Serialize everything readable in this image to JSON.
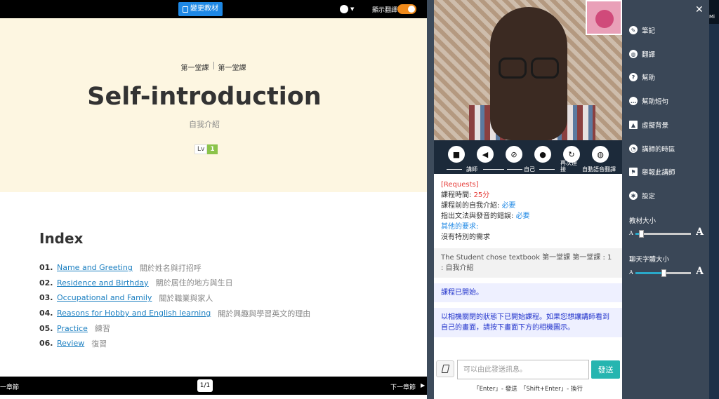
{
  "topbar": {
    "change_textbook": "變更教材",
    "show_translation": "顯示翻譯"
  },
  "lesson": {
    "breadcrumb": [
      "第一堂課",
      "第一堂課"
    ],
    "title": "Self-introduction",
    "subtitle": "自我介紹",
    "level_label": "Lv",
    "level_value": "1",
    "index_title": "Index",
    "index": [
      {
        "no": "01.",
        "title": "Name and Greeting",
        "zh": "關於姓名與打招呼"
      },
      {
        "no": "02.",
        "title": "Residence and Birthday",
        "zh": "關於居住的地方與生日"
      },
      {
        "no": "03.",
        "title": "Occupational and Family",
        "zh": "關於職業與家人"
      },
      {
        "no": "04.",
        "title": "Reasons for Hobby and English learning",
        "zh": "關於興趣與學習英文的理由"
      },
      {
        "no": "05.",
        "title": "Practice",
        "zh": "練習"
      },
      {
        "no": "06.",
        "title": "Review",
        "zh": "復習"
      }
    ]
  },
  "bottombar": {
    "prev": "一章節",
    "page": "1/1",
    "next": "下一章節"
  },
  "controls": {
    "tutor": "講師",
    "self": "自己",
    "reconnect": "再次連接",
    "auto_translate": "自動語音翻譯"
  },
  "chat": {
    "requests_title": "[Requests]",
    "duration_label": "課程時間: ",
    "duration_value": "25分",
    "intro_label": "課程前的自我介紹: ",
    "intro_value": "必要",
    "correction_label": "指出文法與發音的錯誤: ",
    "correction_value": "必要",
    "other_label": "其他的要求:",
    "other_value": "沒有特別的需求",
    "textbook_msg": "The Student chose textbook 第一堂課 第一堂課 : 1 : 自我介紹",
    "started_msg": "課程已開始。",
    "camera_msg": "以相機關閉的狀態下已開始課程。如果您想讓講師看到自己的畫面，請按下畫面下方的相機圖示。"
  },
  "composer": {
    "placeholder": "可以由此發送訊息。",
    "send": "發送",
    "hint": "「Enter」- 發送　「Shift+Enter」- 換行"
  },
  "menu": {
    "items": [
      {
        "label": "筆記",
        "icon": "edit-icon"
      },
      {
        "label": "翻譯",
        "icon": "globe-icon"
      },
      {
        "label": "幫助",
        "icon": "help-icon"
      },
      {
        "label": "幫助短句",
        "icon": "chat-bubble-icon"
      },
      {
        "label": "虛擬背景",
        "icon": "image-icon"
      },
      {
        "label": "講師的時區",
        "icon": "world-clock-icon"
      },
      {
        "label": "舉報此講師",
        "icon": "flag-icon"
      },
      {
        "label": "設定",
        "icon": "gear-icon"
      }
    ],
    "textbook_size": "教材大小",
    "chat_font_size": "聊天字體大小",
    "small_a": "A",
    "big_a": "A",
    "textbook_size_level": 0.1,
    "chat_font_size_level": 0.5
  },
  "edge_label": "Mi",
  "colors": {
    "accent_blue": "#1e88e5",
    "toggle_orange": "#f08a1a",
    "send_teal": "#26b5b0",
    "hero_cream": "#fdf6e1",
    "level_green": "#8bc34a"
  }
}
